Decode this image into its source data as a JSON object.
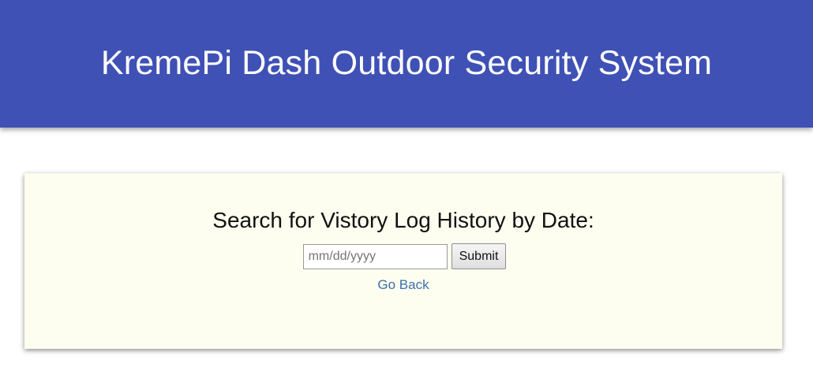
{
  "header": {
    "title": "KremePi Dash Outdoor Security System"
  },
  "search": {
    "heading": "Search for Vistory Log History by Date:",
    "date_placeholder": "mm/dd/yyyy",
    "submit_label": "Submit",
    "back_link": "Go Back"
  },
  "colors": {
    "header_bg": "#3f51b5",
    "card_bg": "#fdfef0",
    "link": "#3d70a8"
  }
}
